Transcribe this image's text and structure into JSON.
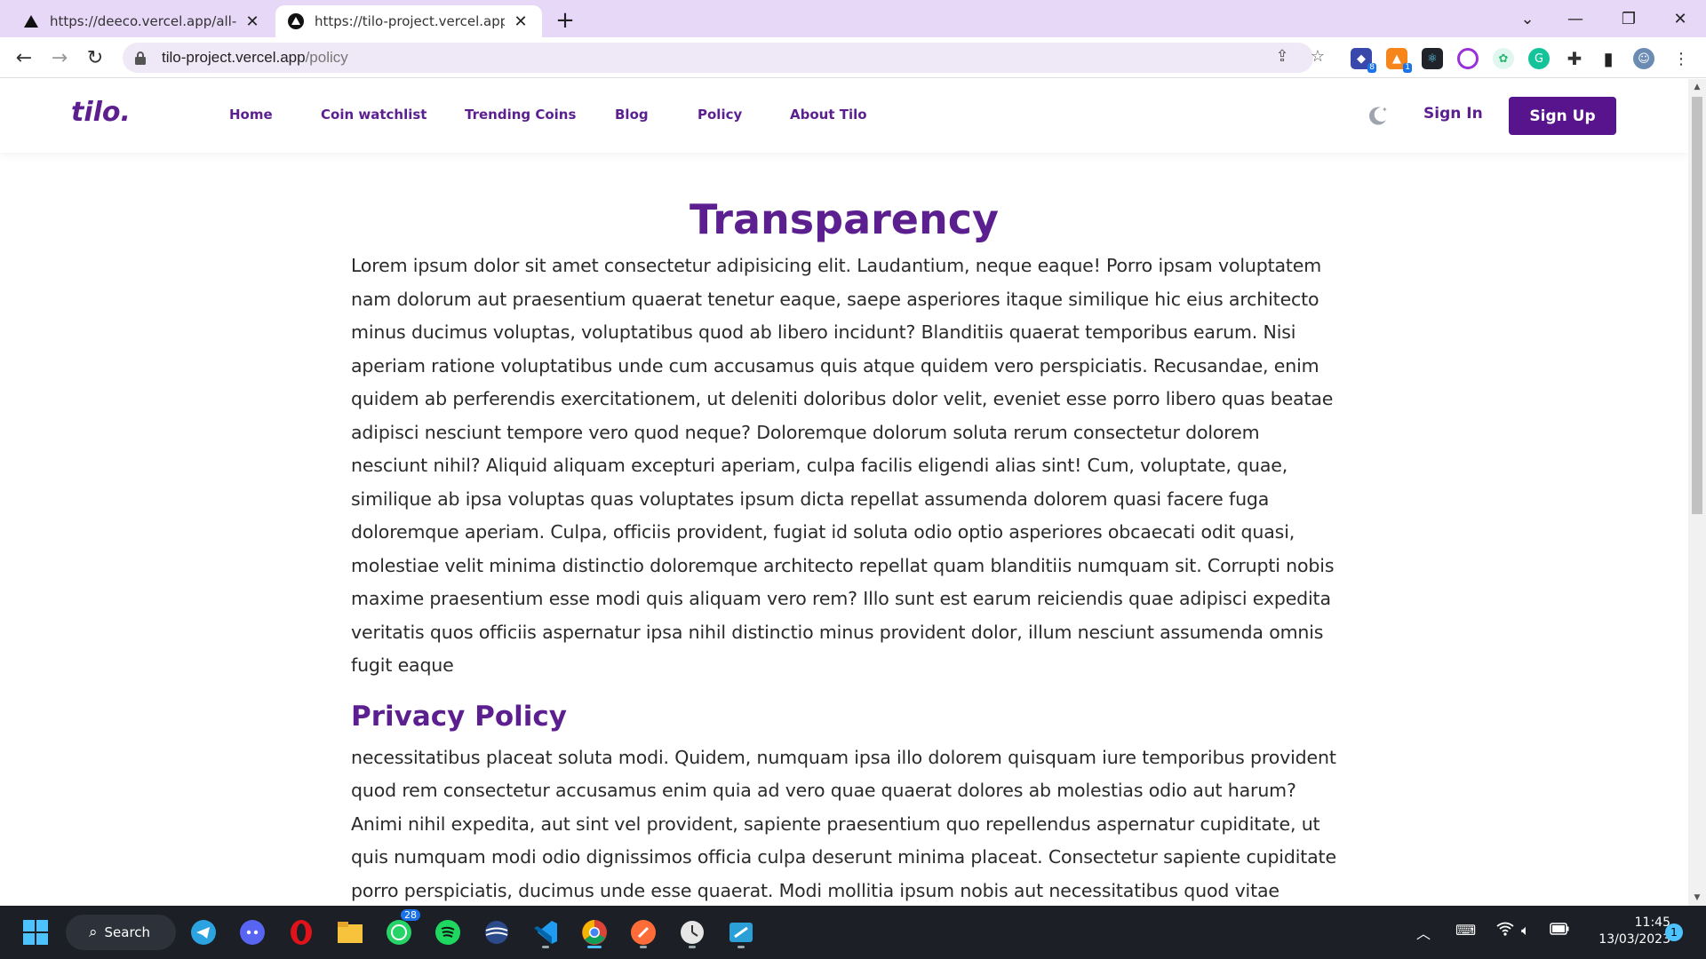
{
  "browser": {
    "tabs": [
      {
        "title": "https://deeco.vercel.app/all-prod",
        "active": false
      },
      {
        "title": "https://tilo-project.vercel.app/po",
        "active": true
      }
    ],
    "new_tab": "+",
    "address": {
      "host": "tilo-project.vercel.app",
      "path": "/policy"
    },
    "extension_badges": {
      "ext1": "8",
      "ext2": "1"
    }
  },
  "site": {
    "logo": "tilo.",
    "nav": [
      "Home",
      "Coin watchlist",
      "Trending Coins",
      "Blog",
      "Policy",
      "About Tilo"
    ],
    "sign_in": "Sign In",
    "sign_up": "Sign Up",
    "accent_color": "#5b1f8f"
  },
  "content": {
    "transparency_title": "Transparency",
    "transparency_text": "Lorem ipsum dolor sit amet consectetur adipisicing elit. Laudantium, neque eaque! Porro ipsam voluptatem nam dolorum aut praesentium quaerat tenetur eaque, saepe asperiores itaque similique hic eius architecto minus ducimus voluptas, voluptatibus quod ab libero incidunt? Blanditiis quaerat temporibus earum. Nisi aperiam ratione voluptatibus unde cum accusamus quis atque quidem vero perspiciatis. Recusandae, enim quidem ab perferendis exercitationem, ut deleniti doloribus dolor velit, eveniet esse porro libero quas beatae adipisci nesciunt tempore vero quod neque? Doloremque dolorum soluta rerum consectetur dolorem nesciunt nihil? Aliquid aliquam excepturi aperiam, culpa facilis eligendi alias sint! Cum, voluptate, quae, similique ab ipsa voluptas quas voluptates ipsum dicta repellat assumenda dolorem quasi facere fuga doloremque aperiam. Culpa, officiis provident, fugiat id soluta odio optio asperiores obcaecati odit quasi, molestiae velit minima distinctio doloremque architecto repellat quam blanditiis numquam sit. Corrupti nobis maxime praesentium esse modi quis aliquam vero rem? Illo sunt est earum reiciendis quae adipisci expedita veritatis quos officiis aspernatur ipsa nihil distinctio minus provident dolor, illum nesciunt assumenda omnis fugit eaque",
    "privacy_title": "Privacy Policy",
    "privacy_text": "necessitatibus placeat soluta modi. Quidem, numquam ipsa illo dolorem quisquam iure temporibus provident quod rem consectetur accusamus enim quia ad vero quae quaerat dolores ab molestias odio aut harum? Animi nihil expedita, aut sint vel provident, sapiente praesentium quo repellendus aspernatur cupiditate, ut quis numquam modi odio dignissimos officia culpa deserunt minima placeat. Consectetur sapiente cupiditate porro perspiciatis, ducimus unde esse quaerat. Modi mollitia ipsum nobis aut necessitatibus quod vitae nesciunt, sequi reiciendis iure fuga quos optio odio! Voluptatum, esse. Iusto, tenetur ut excepturi odio perferendis voluptatibus reprehenderit in dolor nam"
  },
  "taskbar": {
    "search_label": "Search",
    "whatsapp_badge": "28",
    "time": "11:45",
    "date": "13/03/2023",
    "notifications": "1"
  }
}
